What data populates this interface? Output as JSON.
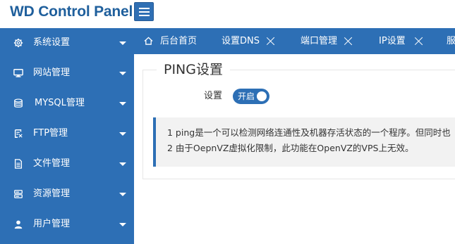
{
  "header": {
    "brand": "WD Control Panel",
    "menu_toggle_icon": "hamburger-icon"
  },
  "colors": {
    "primary": "#2d6fb5",
    "brand_text": "#1f5f9c",
    "note_bg": "#f2f2f2"
  },
  "sidebar": {
    "items": [
      {
        "label": "系统设置",
        "icon": "gear-icon"
      },
      {
        "label": "网站管理",
        "icon": "monitor-icon"
      },
      {
        "label": "MYSQL管理",
        "icon": "database-icon"
      },
      {
        "label": "FTP管理",
        "icon": "ftp-icon"
      },
      {
        "label": "文件管理",
        "icon": "file-icon"
      },
      {
        "label": "资源管理",
        "icon": "server-icon"
      },
      {
        "label": "用户管理",
        "icon": "user-icon"
      }
    ]
  },
  "tabs": [
    {
      "label": "后台首页",
      "icon": "home-icon",
      "closable": false
    },
    {
      "label": "设置DNS",
      "closable": true
    },
    {
      "label": "端口管理",
      "closable": true
    },
    {
      "label": "IP设置",
      "closable": true
    },
    {
      "label": "服",
      "closable": false
    }
  ],
  "main": {
    "section_title": "PING设置",
    "setting_label": "设置",
    "toggle": {
      "label": "开启",
      "state": "on"
    },
    "notes": [
      "1 ping是一个可以检测网络连通性及机器存活状态的一个程序。但同时也",
      "2 由于OepnVZ虚拟化限制，此功能在OpenVZ的VPS上无效。"
    ]
  }
}
